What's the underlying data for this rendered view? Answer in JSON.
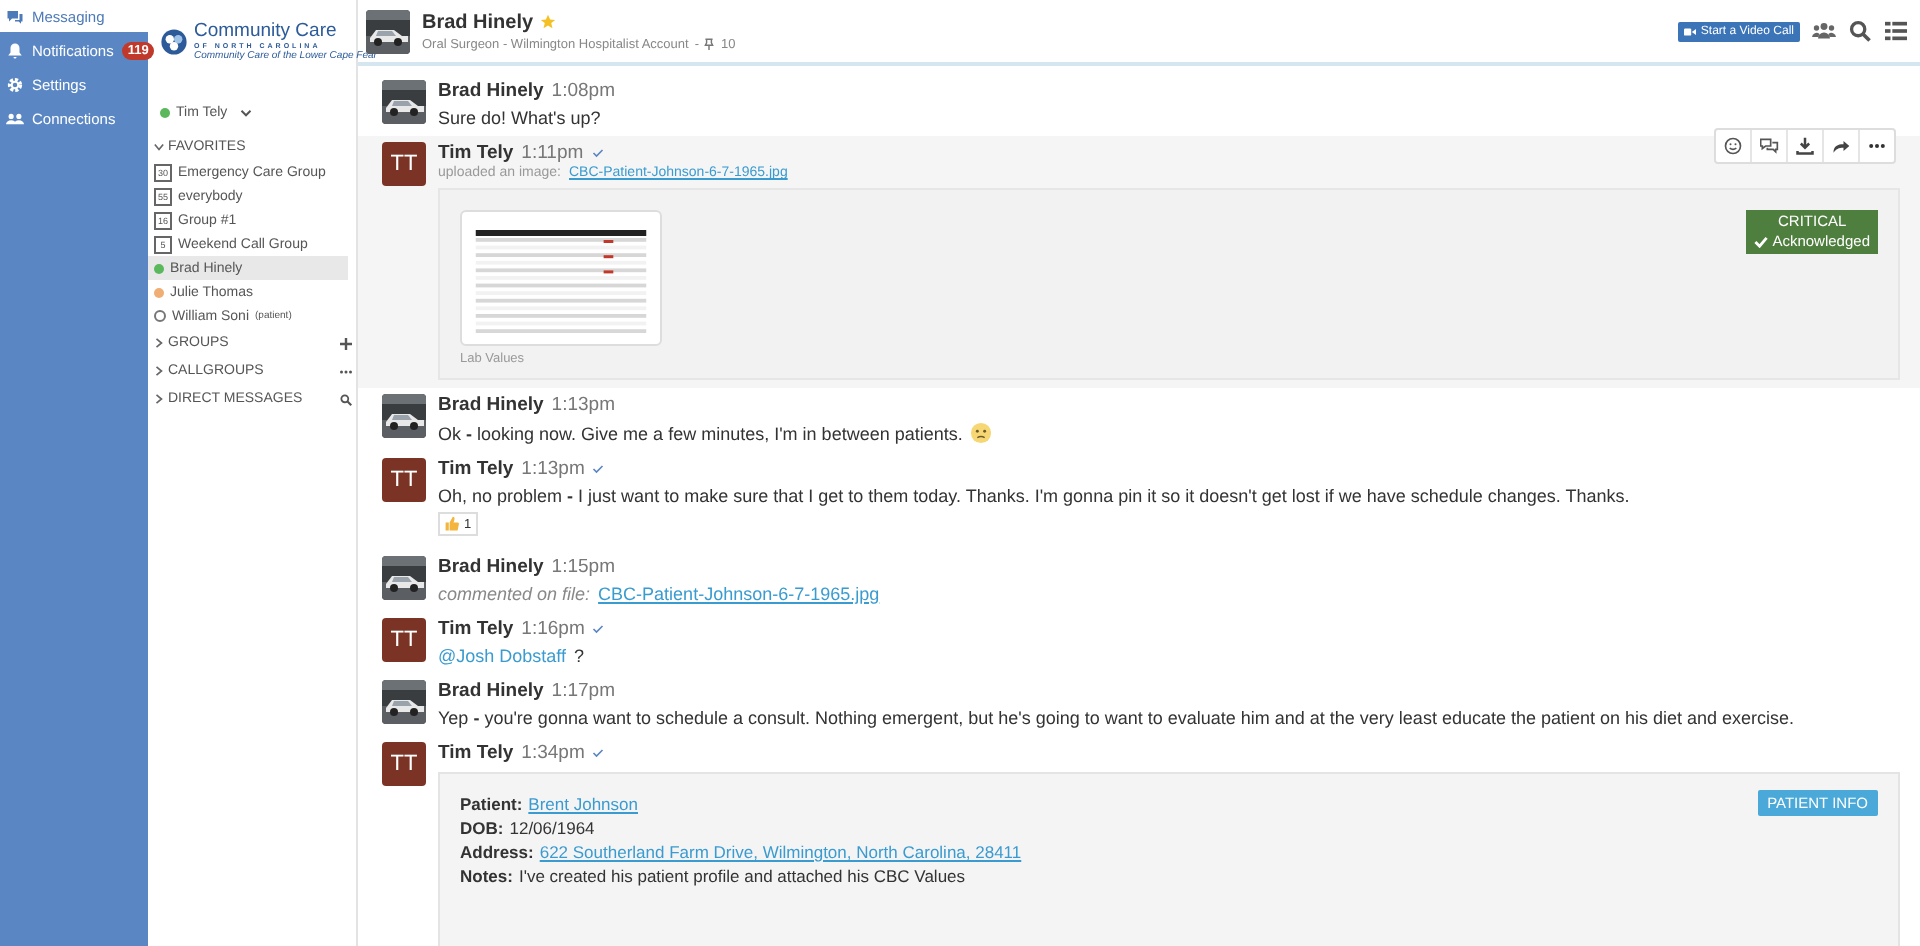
{
  "nav": {
    "items": [
      {
        "label": "Messaging",
        "selected": true
      },
      {
        "label": "Notifications",
        "selected": false,
        "badge": "119"
      },
      {
        "label": "Settings",
        "selected": false
      },
      {
        "label": "Connections",
        "selected": false
      }
    ]
  },
  "sidebar": {
    "logo": {
      "name": "Community Care",
      "sub": "OF NORTH CAROLINA",
      "tagline": "Community Care of the Lower Cape Fear"
    },
    "user": {
      "name": "Tim Tely",
      "color": "#5cb85c"
    },
    "sections": [
      {
        "label": "FAVORITES",
        "expanded": true,
        "items": [
          {
            "kind": "group",
            "count": "30",
            "label": "Emergency Care Group",
            "selected": false
          },
          {
            "kind": "group",
            "count": "55",
            "label": "everybody",
            "selected": false
          },
          {
            "kind": "group",
            "count": "16",
            "label": "Group #1",
            "selected": false
          },
          {
            "kind": "group",
            "count": "5",
            "label": "Weekend Call Group",
            "selected": false
          },
          {
            "kind": "person",
            "color": "#5cb85c",
            "label": "Brad Hinely",
            "selected": true
          },
          {
            "kind": "person",
            "color": "#f0ad74",
            "label": "Julie Thomas",
            "selected": false
          },
          {
            "kind": "patient",
            "label": "William Soni",
            "note": "(patient)",
            "selected": false
          }
        ]
      },
      {
        "label": "GROUPS",
        "expanded": false,
        "kind": "add"
      },
      {
        "label": "CALLGROUPS",
        "expanded": false,
        "kind": "more"
      },
      {
        "label": "DIRECT MESSAGES",
        "expanded": false,
        "kind": "search"
      }
    ]
  },
  "header": {
    "name": "Brad Hinely",
    "starred": true,
    "subtitle": "Oral Surgeon - Wilmington Hospitalist Account",
    "separator": "-",
    "pins": "10",
    "video_button": "Start a Video Call"
  },
  "messages": [
    {
      "kind": "text",
      "author": "Brad Hinely",
      "time": "1:08pm",
      "read": false,
      "text": "Sure do! What's up?"
    },
    {
      "kind": "upload",
      "author": "Tim Tely",
      "avatar": "TT",
      "time": "1:11pm",
      "read": true,
      "hovered": true,
      "action": "uploaded an image:",
      "file": "CBC-Patient-Johnson-6-7-1965.jpg",
      "caption": "Lab Values",
      "status": "CRITICAL",
      "status_note": "Acknowledged"
    },
    {
      "kind": "text",
      "author": "Brad Hinely",
      "time": "1:13pm",
      "read": false,
      "text": "Ok **-** looking now. Give me a few minutes, I'm in between patients.",
      "emoji": true
    },
    {
      "kind": "text",
      "author": "Tim Tely",
      "avatar": "TT",
      "time": "1:13pm",
      "read": true,
      "text": "Oh, no problem **-** I just want to make sure that I get to them today. Thanks. I'm gonna pin it so it doesn't get lost if we have schedule changes. Thanks.",
      "reaction": "1"
    },
    {
      "kind": "comment",
      "author": "Brad Hinely",
      "time": "1:15pm",
      "read": false,
      "action": "commented on file:",
      "file": "CBC-Patient-Johnson-6-7-1965.jpg"
    },
    {
      "kind": "mention",
      "author": "Tim Tely",
      "avatar": "TT",
      "time": "1:16pm",
      "read": true,
      "mention": "@Josh Dobstaff",
      "text": "?"
    },
    {
      "kind": "text",
      "author": "Brad Hinely",
      "time": "1:17pm",
      "read": false,
      "text": "Yep **-** you're gonna want to schedule a consult. Nothing emergent, but he's going to want to evaluate him and at the very least educate the patient on his diet and exercise."
    },
    {
      "kind": "card",
      "author": "Tim Tely",
      "avatar": "TT",
      "time": "1:34pm",
      "read": true,
      "badge": "PATIENT INFO",
      "fields": [
        {
          "label": "Patient:",
          "value": "Brent Johnson",
          "link": true
        },
        {
          "label": "DOB:",
          "value": "12/06/1964",
          "link": false
        },
        {
          "label": "Address:",
          "value": "622 Southerland Farm Drive, Wilmington, North Carolina, 28411",
          "link": true
        },
        {
          "label": "Notes:",
          "value": "I've created his patient profile and attached his CBC Values",
          "link": false
        }
      ]
    }
  ]
}
